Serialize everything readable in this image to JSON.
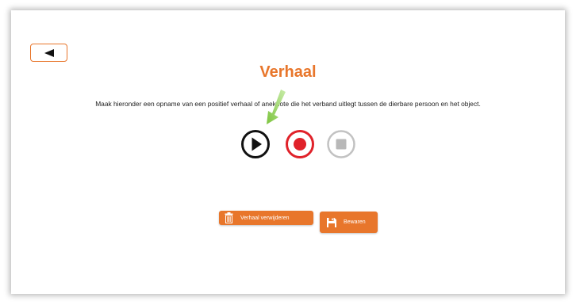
{
  "page": {
    "title": "Verhaal",
    "instruction": "Maak hieronder een opname van een positief verhaal of anekdote die het verband uitlegt tussen de dierbare persoon en het object."
  },
  "controls": {
    "play_icon": "play-icon",
    "record_icon": "record-icon",
    "stop_icon": "stop-icon"
  },
  "actions": {
    "delete_label": "Verhaal verwijderen",
    "save_label": "Bewaren"
  },
  "colors": {
    "accent": "#e8762b",
    "record": "#e0222a",
    "disabled": "#b8b8b8",
    "pointer": "#8fd14f"
  }
}
